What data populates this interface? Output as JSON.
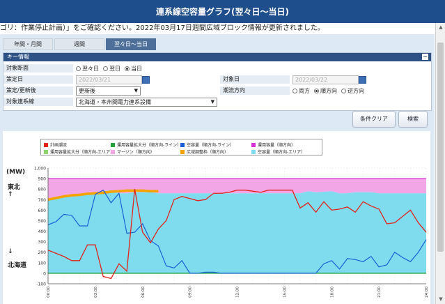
{
  "window": {
    "title": "連系線空容量グラフ(翌々日～当日)"
  },
  "notice": {
    "text": "ゴリ：作業停止計画）」をご確認ください。2022年03月17日週間広域ブロック情報が更新されました。"
  },
  "tabs": [
    {
      "label": "年間・月間",
      "active": false
    },
    {
      "label": "週間",
      "active": false
    },
    {
      "label": "翌々日～当日",
      "active": true
    }
  ],
  "key_info": {
    "header": "キー情報",
    "collapse_glyph": "−",
    "target_section_label": "対象断面",
    "target_section_options": [
      "翌々日",
      "翌日",
      "当日"
    ],
    "target_section_selected": 2,
    "decided_date_label": "策定日",
    "decided_date_value": "2022/03/21",
    "target_date_label": "対象日",
    "target_date_value": "2022/03/22",
    "decide_update_label": "策定/更新後",
    "decide_update_value": "更新後",
    "flow_direction_label": "潮流方向",
    "flow_direction_options": [
      "両方",
      "順方向",
      "逆方向"
    ],
    "flow_direction_selected": 1,
    "interconnection_label": "対象連系線",
    "interconnection_value": "北海道・本州間電力連系設備"
  },
  "buttons": {
    "clear": "条件クリア",
    "search": "検索"
  },
  "sides": {
    "unit": "(MW)",
    "top_area": "東北",
    "top_arrow": "↑",
    "bottom_arrow": "↓",
    "bottom_area": "北海道"
  },
  "legend": [
    {
      "label": "計画潮流",
      "color": "#e2231a"
    },
    {
      "label": "運用容量拡大分（順方向-ライン）",
      "color": "#22a338"
    },
    {
      "label": "空容量（順方向-ライン）",
      "color": "#1a5fd6"
    },
    {
      "label": "運用容量（順方向）",
      "color": "#d633d6"
    },
    {
      "label": "運用容量拡大分（順方向-エリア）",
      "color": "#8fd46a"
    },
    {
      "label": "マージン（順方向）",
      "color": "#f3a6e6"
    },
    {
      "label": "広域調整枠（順方向）",
      "color": "#f4a300"
    },
    {
      "label": "空容量（順方向-エリア）",
      "color": "#7fdcef"
    }
  ],
  "chart_data": {
    "type": "area",
    "ylim": [
      -100,
      1000
    ],
    "y_ticks": [
      "1,000",
      "900",
      "800",
      "700",
      "600",
      "500",
      "400",
      "300",
      "200",
      "100",
      "0",
      "-100"
    ],
    "x_ticks": [
      "00:00",
      "03:00",
      "06:00",
      "09:00",
      "12:00",
      "15:00",
      "18:00",
      "21:00",
      "24:00"
    ],
    "x_hours": [
      0,
      0.5,
      1,
      1.5,
      2,
      2.5,
      3,
      3.5,
      4,
      4.5,
      5,
      5.5,
      6,
      6.5,
      7,
      7.5,
      8,
      8.5,
      9,
      9.5,
      10,
      10.5,
      11,
      11.5,
      12,
      12.5,
      13,
      13.5,
      14,
      14.5,
      15,
      15.5,
      16,
      16.5,
      17,
      17.5,
      18,
      18.5,
      19,
      19.5,
      20,
      20.5,
      21,
      21.5,
      22,
      22.5,
      23,
      23.5,
      24
    ],
    "series": [
      {
        "name": "運用容量（順方向）",
        "values": [
          900,
          900,
          900,
          900,
          900,
          900,
          900,
          900,
          900,
          900,
          900,
          900,
          900,
          900,
          900,
          900,
          900,
          900,
          900,
          900,
          900,
          900,
          900,
          900,
          900,
          900,
          900,
          900,
          900,
          900,
          900,
          900,
          900,
          900,
          900,
          900,
          900,
          900,
          900,
          900,
          900,
          900,
          900,
          900,
          900,
          900,
          900,
          900,
          900
        ]
      },
      {
        "name": "広域調整枠（順方向）",
        "values": [
          700,
          715,
          730,
          740,
          745,
          755,
          760,
          765,
          775,
          780,
          785,
          785,
          785,
          780,
          780,
          null,
          null,
          null,
          null,
          null,
          null,
          null,
          null,
          null,
          null,
          null,
          null,
          null,
          null,
          null,
          null,
          null,
          null,
          null,
          null,
          null,
          null,
          null,
          null,
          null,
          null,
          null,
          null,
          null,
          null,
          null,
          null,
          null,
          null
        ]
      },
      {
        "name": "空容量（順方向-エリア）",
        "values": [
          700,
          710,
          720,
          730,
          740,
          750,
          755,
          780,
          790,
          760,
          760,
          770,
          770,
          770,
          760,
          760,
          760,
          760,
          760,
          760,
          760,
          760,
          760,
          760,
          760,
          760,
          760,
          760,
          760,
          760,
          760,
          760,
          760,
          780,
          770,
          775,
          780,
          760,
          760,
          770,
          770,
          770,
          760,
          760,
          760,
          760,
          760,
          760,
          760
        ]
      },
      {
        "name": "計画潮流",
        "values": [
          220,
          190,
          160,
          120,
          120,
          270,
          270,
          -30,
          -50,
          90,
          20,
          800,
          390,
          290,
          420,
          500,
          700,
          730,
          710,
          690,
          700,
          760,
          760,
          770,
          790,
          790,
          780,
          770,
          790,
          790,
          790,
          790,
          620,
          670,
          580,
          680,
          600,
          610,
          630,
          580,
          680,
          640,
          610,
          470,
          480,
          540,
          600,
          480,
          390
        ]
      },
      {
        "name": "空容量（順方向-ライン）",
        "values": [
          460,
          490,
          560,
          550,
          450,
          450,
          750,
          790,
          670,
          760,
          380,
          390,
          470,
          310,
          260,
          70,
          50,
          120,
          0,
          0,
          10,
          10,
          0,
          0,
          0,
          0,
          0,
          0,
          0,
          0,
          0,
          0,
          0,
          0,
          0,
          90,
          120,
          40,
          140,
          130,
          110,
          160,
          60,
          80,
          200,
          150,
          110,
          200,
          320
        ]
      },
      {
        "name": "運用容量拡大分（順方向-ライン）",
        "values": [
          0,
          0,
          0,
          0,
          0,
          0,
          0,
          0,
          0,
          0,
          0,
          0,
          0,
          0,
          0,
          0,
          0,
          0,
          0,
          0,
          0,
          0,
          0,
          0,
          0,
          0,
          0,
          0,
          0,
          0,
          0,
          0,
          0,
          0,
          0,
          0,
          0,
          0,
          0,
          0,
          0,
          0,
          0,
          0,
          0,
          0,
          0,
          0,
          0
        ]
      }
    ]
  }
}
